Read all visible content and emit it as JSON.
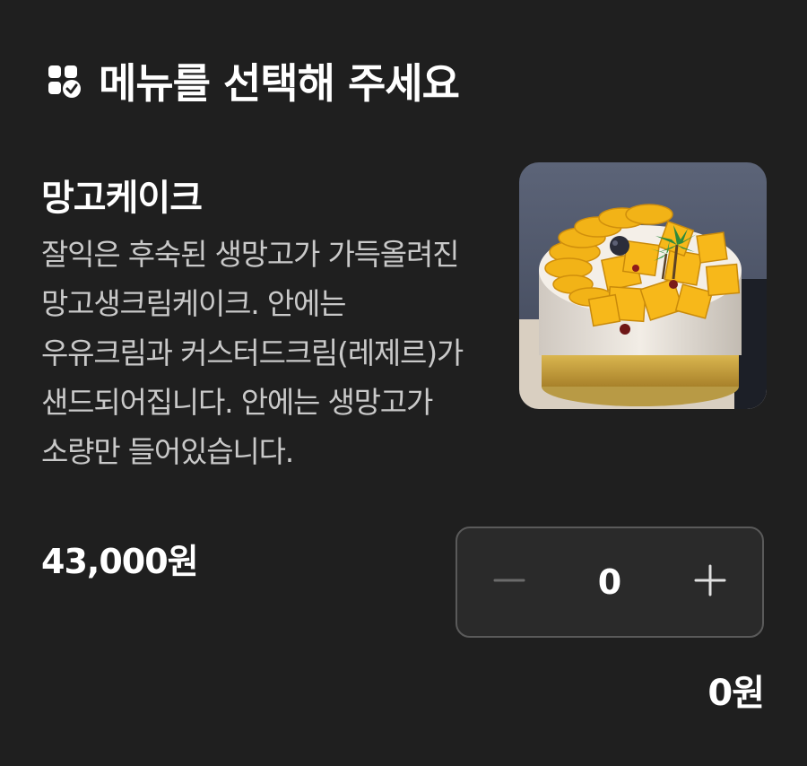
{
  "header": {
    "title": "메뉴를 선택해 주세요",
    "icon": "menu-check-icon"
  },
  "item": {
    "name": "망고케이크",
    "description": "잘익은 후숙된 생망고가 가득올려진 망고생크림케이크. 안에는 우유크림과 커스터드크림(레제르)가 샌드되어집니다. 안에는 생망고가 소량만 들어있습니다.",
    "image_icon": "mango-cake-photo",
    "price": "43,000원",
    "quantity": "0",
    "total": "0원",
    "decrease_icon": "minus-icon",
    "increase_icon": "plus-icon"
  },
  "colors": {
    "background": "#1f1f1f",
    "text": "#ffffff",
    "description_text": "#c9c9c9",
    "stepper_border": "#5a5a5a",
    "stepper_minus": "#6b6b6b",
    "stepper_plus": "#e0e0e0"
  }
}
